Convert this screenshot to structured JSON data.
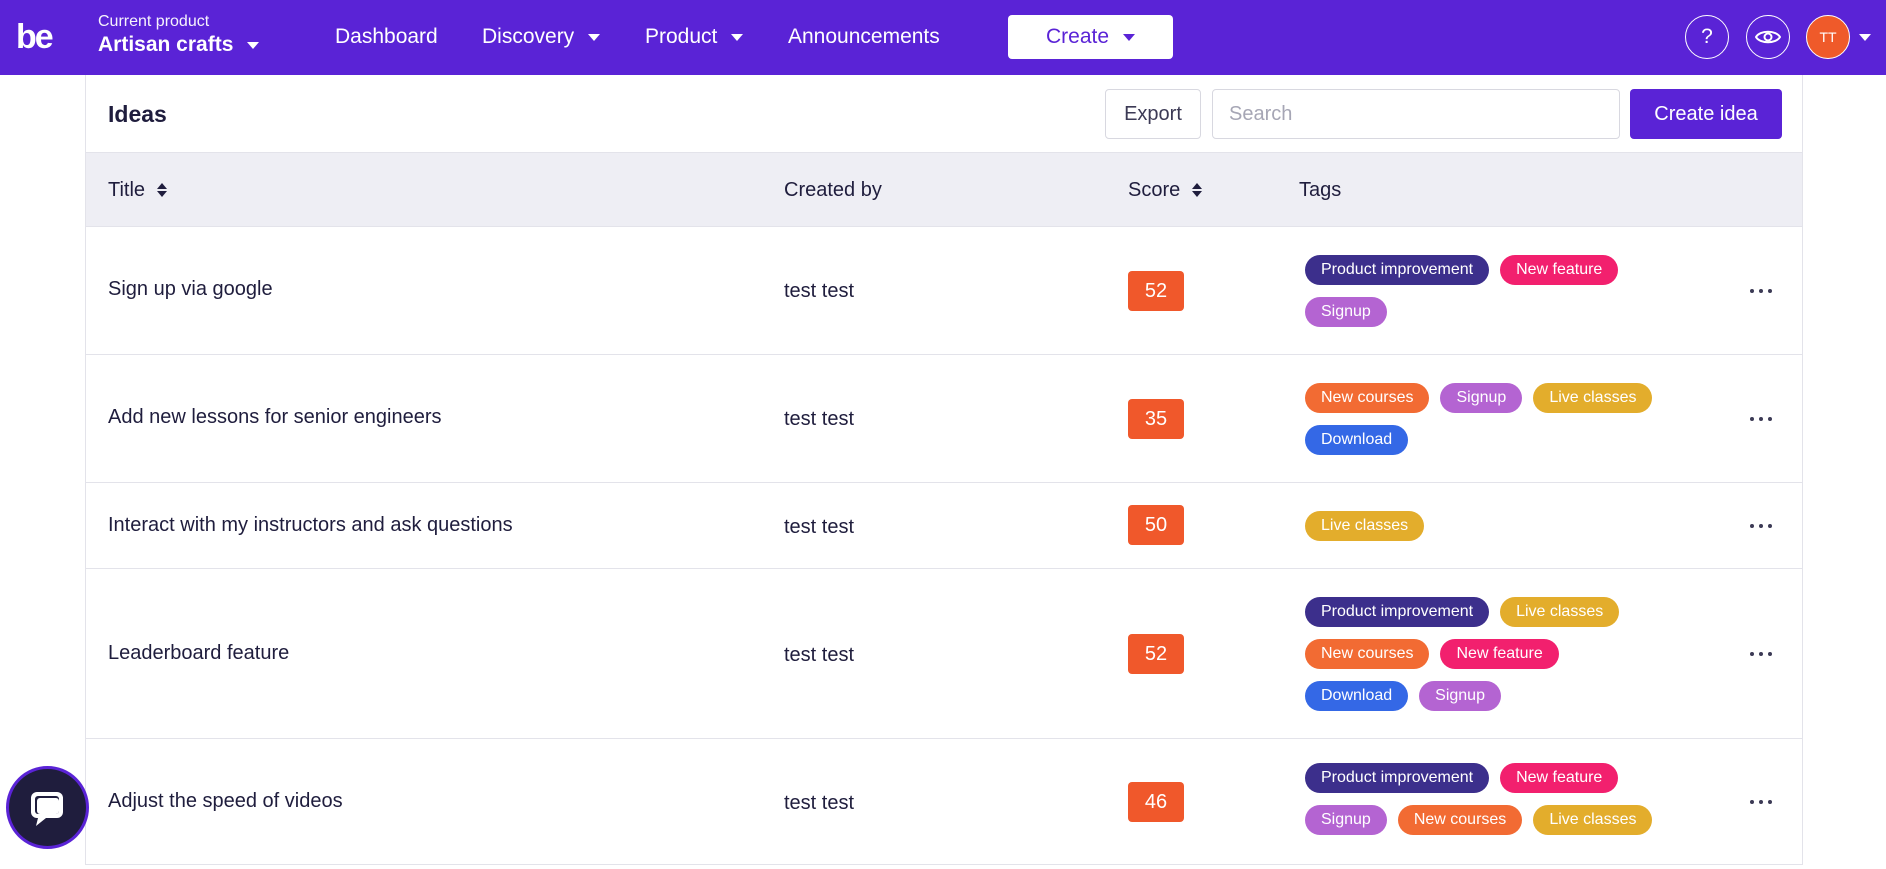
{
  "topbar": {
    "logo": "be",
    "product_caption": "Current product",
    "product_name": "Artisan crafts",
    "nav": [
      {
        "label": "Dashboard"
      },
      {
        "label": "Discovery"
      },
      {
        "label": "Product"
      },
      {
        "label": "Announcements"
      }
    ],
    "create_label": "Create",
    "help_glyph": "?",
    "avatar_initials": "TT",
    "brand_color": "#5a23d6"
  },
  "ideas": {
    "title": "Ideas",
    "export_label": "Export",
    "search_placeholder": "Search",
    "create_label": "Create idea",
    "columns": {
      "title": "Title",
      "created_by": "Created by",
      "score": "Score",
      "tags": "Tags"
    },
    "rows": [
      {
        "title": "Sign up via google",
        "created_by": "test test",
        "score": "52",
        "tags": [
          "Product improvement",
          "New feature",
          "Signup"
        ]
      },
      {
        "title": "Add new lessons for senior engineers",
        "created_by": "test test",
        "score": "35",
        "tags": [
          "New courses",
          "Signup",
          "Live classes",
          "Download"
        ]
      },
      {
        "title": "Interact with my instructors and ask questions",
        "created_by": "test test",
        "score": "50",
        "tags": [
          "Live classes"
        ]
      },
      {
        "title": "Leaderboard feature",
        "created_by": "test test",
        "score": "52",
        "tags": [
          "Product improvement",
          "Live classes",
          "New courses",
          "New feature",
          "Download",
          "Signup"
        ]
      },
      {
        "title": "Adjust the speed of videos",
        "created_by": "test test",
        "score": "46",
        "tags": [
          "Product improvement",
          "New feature",
          "Signup",
          "New courses",
          "Live classes"
        ]
      }
    ]
  },
  "tag_colors": {
    "Product improvement": "#3c2f8c",
    "New feature": "#f2206e",
    "Signup": "#b464d2",
    "New courses": "#f26b33",
    "Live classes": "#e3ad2c",
    "Download": "#3468e6"
  },
  "score_color": "#f0582b"
}
